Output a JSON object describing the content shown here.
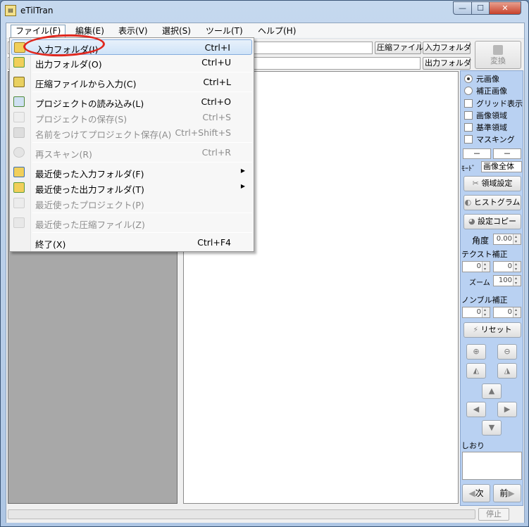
{
  "window": {
    "title": "eTilTran",
    "min": "—",
    "max": "☐",
    "close": "✕"
  },
  "menubar": {
    "items": [
      "ファイル(F)",
      "編集(E)",
      "表示(V)",
      "選択(S)",
      "ツール(T)",
      "ヘルプ(H)"
    ]
  },
  "toolbar": {
    "compress_file_btn": "圧縮ファイル",
    "input_folder_btn": "入力フォルダ",
    "output_folder_btn": "出力フォルダ",
    "convert_btn": "変換"
  },
  "file_menu": {
    "items": [
      {
        "label": "入力フォルダ(I)",
        "shortcut": "Ctrl+I",
        "enabled": true,
        "highlighted": true,
        "icon": "folder-open-icon"
      },
      {
        "label": "出力フォルダ(O)",
        "shortcut": "Ctrl+U",
        "enabled": true,
        "icon": "folder-out-icon"
      },
      {
        "label": "圧縮ファイルから入力(C)",
        "shortcut": "Ctrl+L",
        "enabled": true,
        "icon": "archive-icon"
      },
      {
        "label": "プロジェクトの読み込み(L)",
        "shortcut": "Ctrl+O",
        "enabled": true,
        "icon": "project-open-icon"
      },
      {
        "label": "プロジェクトの保存(S)",
        "shortcut": "Ctrl+S",
        "enabled": false,
        "icon": "save-icon"
      },
      {
        "label": "名前をつけてプロジェクト保存(A)",
        "shortcut": "Ctrl+Shift+S",
        "enabled": false,
        "icon": "save-as-icon"
      },
      {
        "label": "再スキャン(R)",
        "shortcut": "Ctrl+R",
        "enabled": false,
        "icon": "rescan-icon"
      },
      {
        "label": "最近使った入力フォルダ(F)",
        "shortcut": "",
        "enabled": true,
        "submenu": true,
        "icon": "recent-input-icon"
      },
      {
        "label": "最近使った出力フォルダ(T)",
        "shortcut": "",
        "enabled": true,
        "submenu": true,
        "icon": "recent-output-icon"
      },
      {
        "label": "最近使ったプロジェクト(P)",
        "shortcut": "",
        "enabled": false,
        "icon": "recent-project-icon"
      },
      {
        "label": "最近使った圧縮ファイル(Z)",
        "shortcut": "",
        "enabled": false,
        "icon": "recent-archive-icon"
      },
      {
        "label": "終了(X)",
        "shortcut": "Ctrl+F4",
        "enabled": true,
        "icon": ""
      }
    ]
  },
  "right_panel": {
    "radio_original": "元画像",
    "radio_corrected": "補正画像",
    "chk_grid": "グリッド表示",
    "chk_image_area": "画像領域",
    "chk_base_area": "基準領域",
    "chk_masking": "マスキング",
    "dash1": "－",
    "dash2": "－",
    "mode_label": "ﾓｰﾄﾞ",
    "mode_value": "画像全体",
    "area_set_btn": "領域設定",
    "histogram_btn": "ヒストグラム",
    "copy_settings_btn": "設定コピー",
    "angle_label": "角度",
    "angle_value": "0.00",
    "text_correction": "テクスト補正",
    "tc_val1": "0",
    "tc_val2": "0",
    "zoom_label": "ズーム",
    "zoom_value": "100",
    "nombre_correction": "ノンブル補正",
    "nc_val1": "0",
    "nc_val2": "0",
    "reset_btn": "リセット",
    "bookmark_label": "しおり",
    "next_btn": "次",
    "prev_btn": "前"
  },
  "status": {
    "stop_btn": "停止"
  },
  "colors": {
    "highlight_ring": "#e0281e",
    "panel_bg": "#b9d1f2",
    "menu_hl": "#cfe3f8"
  }
}
